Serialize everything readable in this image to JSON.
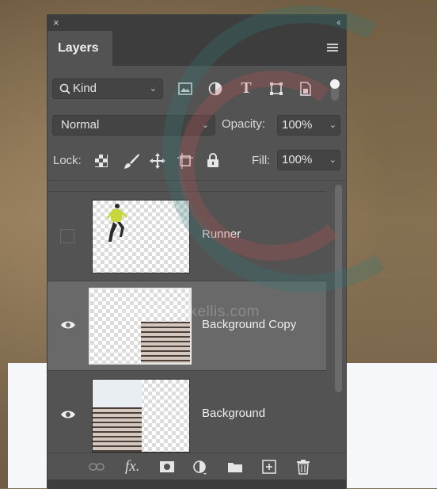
{
  "panel": {
    "close_glyph": "×",
    "collapse_glyph": "‹‹",
    "tab_label": "Layers"
  },
  "filter": {
    "kind_label": "Kind",
    "filter_icons": [
      "image-filter-icon",
      "adjustment-filter-icon",
      "type-filter-icon",
      "shape-filter-icon",
      "smart-object-filter-icon"
    ]
  },
  "blend": {
    "mode": "Normal",
    "opacity_label": "Opacity:",
    "opacity_value": "100%"
  },
  "lock": {
    "label": "Lock:",
    "fill_label": "Fill:",
    "fill_value": "100%"
  },
  "layers": [
    {
      "name": "Runner",
      "visible": false,
      "selected": false
    },
    {
      "name": "Background Copy",
      "visible": true,
      "selected": true
    },
    {
      "name": "Background",
      "visible": true,
      "selected": false
    }
  ],
  "footer_icons": [
    "link-layers-icon",
    "fx-icon",
    "mask-icon",
    "adjustment-layer-icon",
    "group-folder-icon",
    "new-layer-icon",
    "trash-icon"
  ],
  "watermark": "Rutiesteinkellis.com",
  "colors": {
    "panel_bg": "#535353",
    "selected_row": "#696969",
    "watermark_red": "#c8514f",
    "watermark_teal": "#2f7b78"
  }
}
